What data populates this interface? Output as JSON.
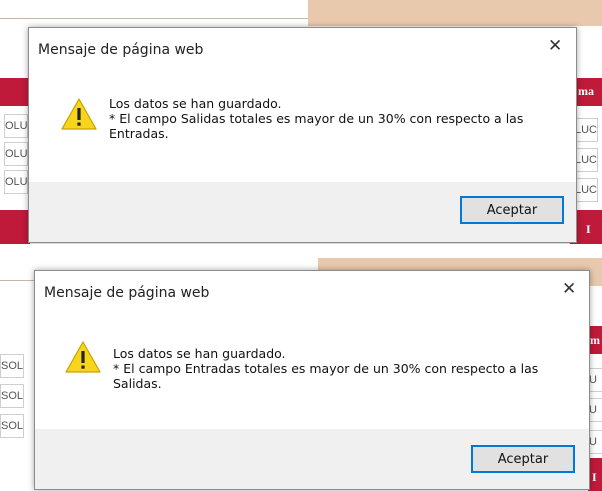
{
  "dialogs": [
    {
      "title": "Mensaje de página web",
      "close_symbol": "✕",
      "line1": "Los datos se han guardado.",
      "line2": "* El campo Salidas totales es mayor de un 30% con respecto a las",
      "line3": "Entradas.",
      "button": "Aceptar",
      "icon": "warning-icon"
    },
    {
      "title": "Mensaje de página web",
      "close_symbol": "✕",
      "line1": "Los datos se han guardado.",
      "line2": "* El campo Entradas totales es mayor de un 30% con respecto a las",
      "line3": "Salidas.",
      "button": "Aceptar",
      "icon": "warning-icon"
    }
  ],
  "background": {
    "top_left_cells": [
      "OLU",
      "OLU",
      "OLU"
    ],
    "top_right_cells": [
      "LUC",
      "LUC",
      "LUC"
    ],
    "top_right_header": "ma",
    "top_right_footer": "I",
    "bottom_left_cells": [
      "SOL",
      "SOL",
      "SOL"
    ],
    "bottom_right_cells": [
      "U",
      "U",
      "U"
    ],
    "bottom_right_header": "m",
    "bottom_right_footer": "I",
    "colors": {
      "header_red": "#c01a3a",
      "tan": "#e8c9ae",
      "accent_blue": "#0078d7"
    }
  }
}
